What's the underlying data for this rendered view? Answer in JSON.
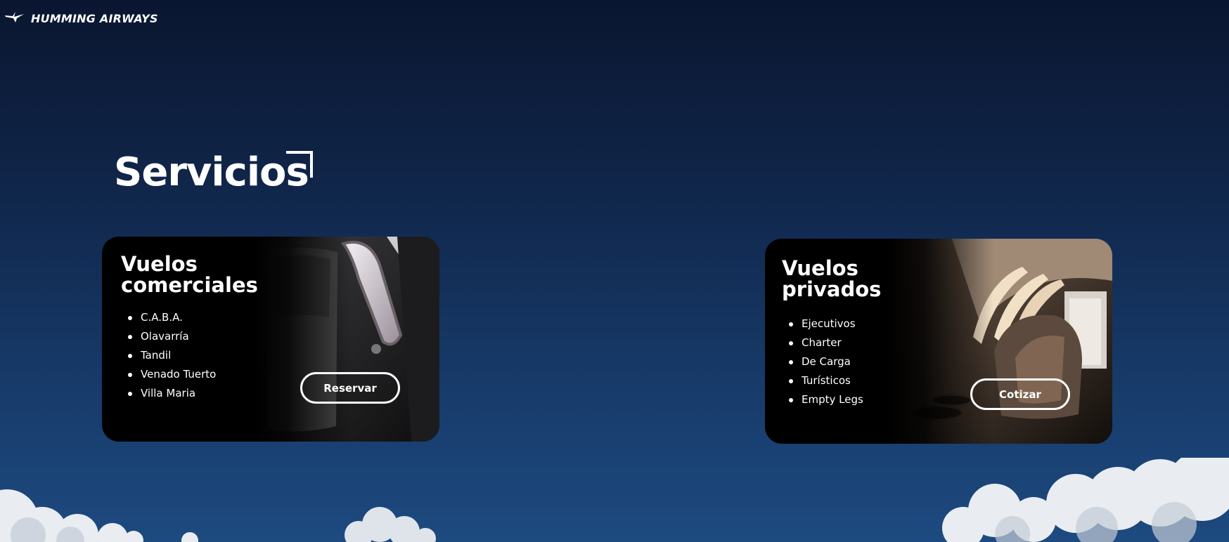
{
  "brand": {
    "name": "HUMMING AIRWAYS",
    "icon": "bird-icon"
  },
  "section": {
    "title": "Servicios"
  },
  "cards": [
    {
      "title_line1": "Vuelos",
      "title_line2": "comerciales",
      "items": [
        "C.A.B.A.",
        "Olavarría",
        "Tandil",
        "Venado Tuerto",
        "Villa Maria"
      ],
      "button": "Reservar"
    },
    {
      "title_line1": "Vuelos",
      "title_line2": "privados",
      "items": [
        "Ejecutivos",
        "Charter",
        "De Carga",
        "Turísticos",
        "Empty Legs"
      ],
      "button": "Cotizar"
    }
  ],
  "colors": {
    "sky_top": "#0a1630",
    "sky_bottom": "#1d4a80",
    "card_bg": "#000000",
    "text": "#ffffff"
  }
}
